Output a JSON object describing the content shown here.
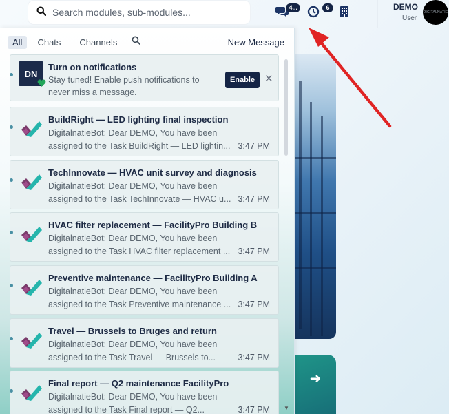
{
  "search": {
    "placeholder": "Search modules, sub-modules..."
  },
  "header": {
    "chat_badge": "4...",
    "activity_badge": "6",
    "user_name": "DEMO",
    "user_role": "User",
    "avatar_text": "DIGITALNATIE"
  },
  "panel": {
    "tabs": [
      "All",
      "Chats",
      "Channels"
    ],
    "new_message": "New Message",
    "push": {
      "avatar": "DN",
      "title": "Turn on notifications",
      "line1": "Stay tuned! Enable push notifications to",
      "line2": "never miss a message.",
      "enable": "Enable",
      "close": "✕"
    },
    "items": [
      {
        "title": "BuildRight — LED lighting final inspection",
        "line1": "DigitalnatieBot: Dear DEMO, You have been",
        "line2": "assigned to the Task BuildRight — LED lightin...",
        "time": "3:47 PM"
      },
      {
        "title": "TechInnovate — HVAC unit survey and diagnosis",
        "line1": "DigitalnatieBot: Dear DEMO, You have been",
        "line2": "assigned to the Task TechInnovate — HVAC u...",
        "time": "3:47 PM"
      },
      {
        "title": "HVAC filter replacement — FacilityPro Building B",
        "line1": "DigitalnatieBot: Dear DEMO, You have been",
        "line2": "assigned to the Task HVAC filter replacement ...",
        "time": "3:47 PM"
      },
      {
        "title": "Preventive maintenance — FacilityPro Building A",
        "line1": "DigitalnatieBot: Dear DEMO, You have been",
        "line2": "assigned to the Task Preventive maintenance ...",
        "time": "3:47 PM"
      },
      {
        "title": "Travel — Brussels to Bruges and return",
        "line1": "DigitalnatieBot: Dear DEMO, You have been",
        "line2": "assigned to the Task Travel — Brussels to...",
        "time": "3:47 PM"
      },
      {
        "title": "Final report — Q2 maintenance FacilityPro",
        "line1": "DigitalnatieBot: Dear DEMO, You have been",
        "line2": "assigned to the Task Final report — Q2...",
        "time": "3:47 PM"
      }
    ]
  },
  "colors": {
    "brand_navy": "#142445",
    "accent_teal": "#1f9488",
    "annotation_red": "#e02424"
  },
  "icons": {
    "search": "search-icon",
    "chat": "chat-bubbles-icon",
    "activity": "activity-icon",
    "building": "building-icon",
    "task_logo": "check-logo-icon"
  }
}
